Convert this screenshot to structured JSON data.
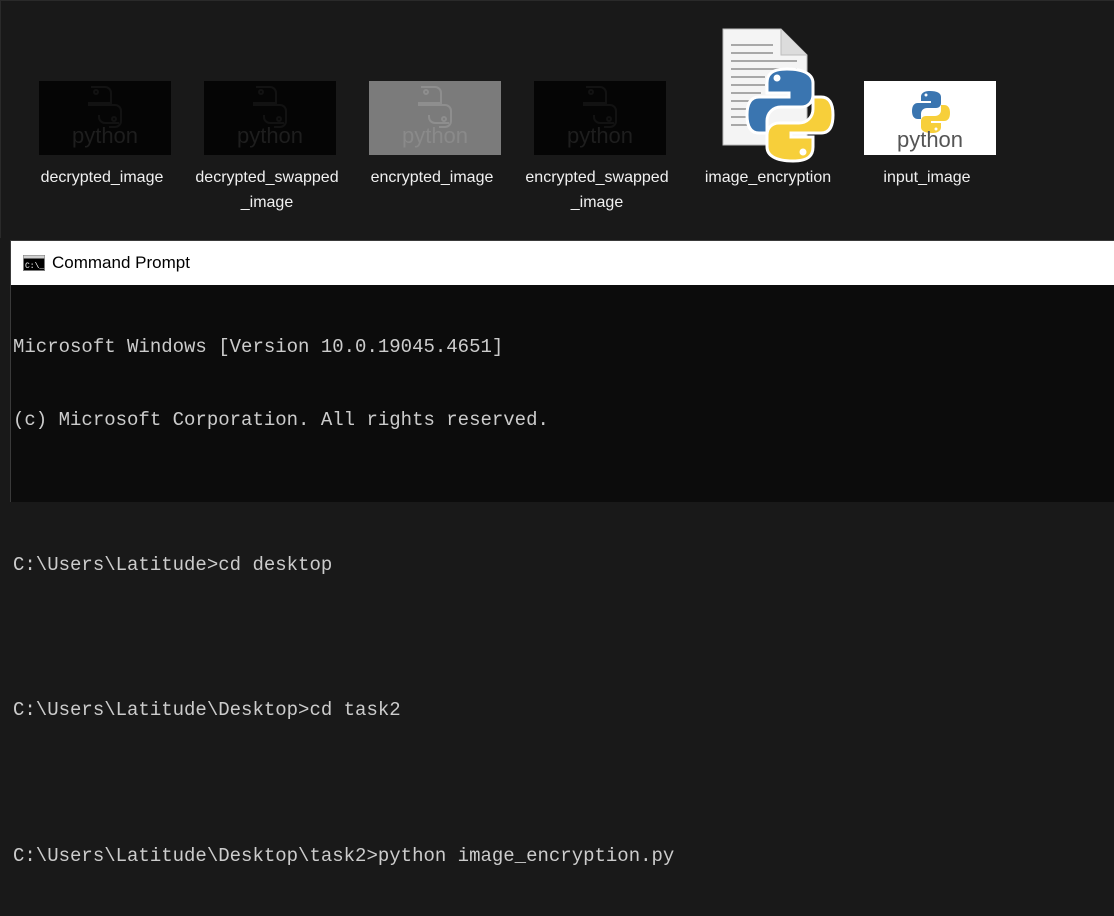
{
  "explorer": {
    "files": [
      {
        "name": "decrypted_image",
        "type": "python-thumbnail-dark",
        "thumb_word": "python"
      },
      {
        "name": "decrypted_swapped_image",
        "type": "python-thumbnail-dark",
        "thumb_word": "python"
      },
      {
        "name": "encrypted_image",
        "type": "python-thumbnail-gray",
        "thumb_word": "python"
      },
      {
        "name": "encrypted_swapped_image",
        "type": "python-thumbnail-dark",
        "thumb_word": "python"
      },
      {
        "name": "image_encryption",
        "type": "python-script-icon"
      },
      {
        "name": "input_image",
        "type": "python-thumbnail-color",
        "thumb_word": "python"
      }
    ]
  },
  "cmd": {
    "title": "Command Prompt",
    "icon": "cmd-icon",
    "lines": [
      "Microsoft Windows [Version 10.0.19045.4651]",
      "(c) Microsoft Corporation. All rights reserved.",
      "",
      "C:\\Users\\Latitude>cd desktop",
      "",
      "C:\\Users\\Latitude\\Desktop>cd task2",
      "",
      "C:\\Users\\Latitude\\Desktop\\task2>python image_encryption.py"
    ]
  },
  "colors": {
    "explorer_bg": "#191919",
    "cmd_bg": "#0c0c0c",
    "cmd_text": "#cccccc",
    "python_blue": "#3a75b0",
    "python_yellow": "#f7cf3a"
  }
}
